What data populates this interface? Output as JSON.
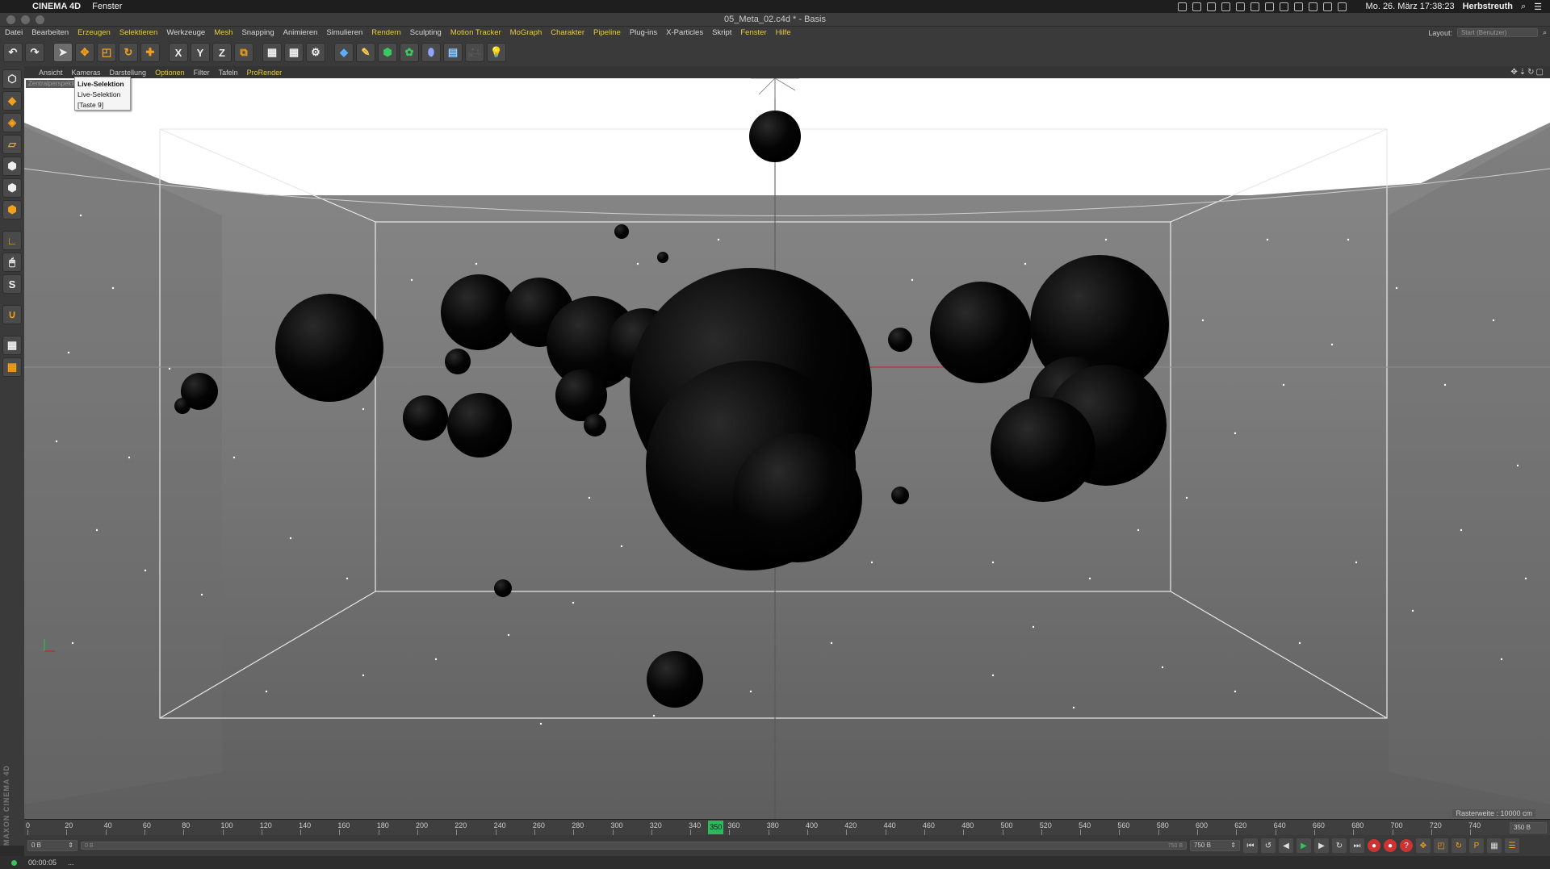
{
  "macos": {
    "app": "CINEMA 4D",
    "menu": "Fenster",
    "datetime": "Mo. 26. März  17:38:23",
    "user": "Herbstreuth"
  },
  "window_title": "05_Meta_02.c4d * - Basis",
  "menu": [
    "Datei",
    "Bearbeiten",
    "Erzeugen",
    "Selektieren",
    "Werkzeuge",
    "Mesh",
    "Snapping",
    "Animieren",
    "Simulieren",
    "Rendern",
    "Sculpting",
    "Motion Tracker",
    "MoGraph",
    "Charakter",
    "Pipeline",
    "Plug-ins",
    "X-Particles",
    "Skript",
    "Fenster",
    "Hilfe"
  ],
  "layout": {
    "label": "Layout:",
    "value": "Start (Benutzer)"
  },
  "viewport_menu": [
    "Ansicht",
    "Kameras",
    "Darstellung",
    "Optionen",
    "Filter",
    "Tafeln",
    "ProRender"
  ],
  "viewport": {
    "camera": "Zentralperspektive",
    "rasterweite": "Rasterweite : 10000 cm"
  },
  "tooltip": {
    "title": "Live-Selektion",
    "desc": "Live-Selektion",
    "shortcut": "[Taste 9]"
  },
  "timeline": {
    "ticks": [
      "0",
      "20",
      "40",
      "60",
      "80",
      "100",
      "120",
      "140",
      "160",
      "180",
      "200",
      "220",
      "240",
      "260",
      "280",
      "300",
      "320",
      "340",
      "360",
      "380",
      "400",
      "420",
      "440",
      "460",
      "480",
      "500",
      "520",
      "540",
      "560",
      "580",
      "600",
      "620",
      "640",
      "660",
      "680",
      "700",
      "720",
      "740"
    ],
    "current": "350",
    "end": "350 B"
  },
  "transport": {
    "start_field": "0 B",
    "range_start": "0 B",
    "range_end": "750 B",
    "end_field": "750 B"
  },
  "status": {
    "time": "00:00:05",
    "msg": "..."
  },
  "brand": "MAXON CINEMA 4D"
}
